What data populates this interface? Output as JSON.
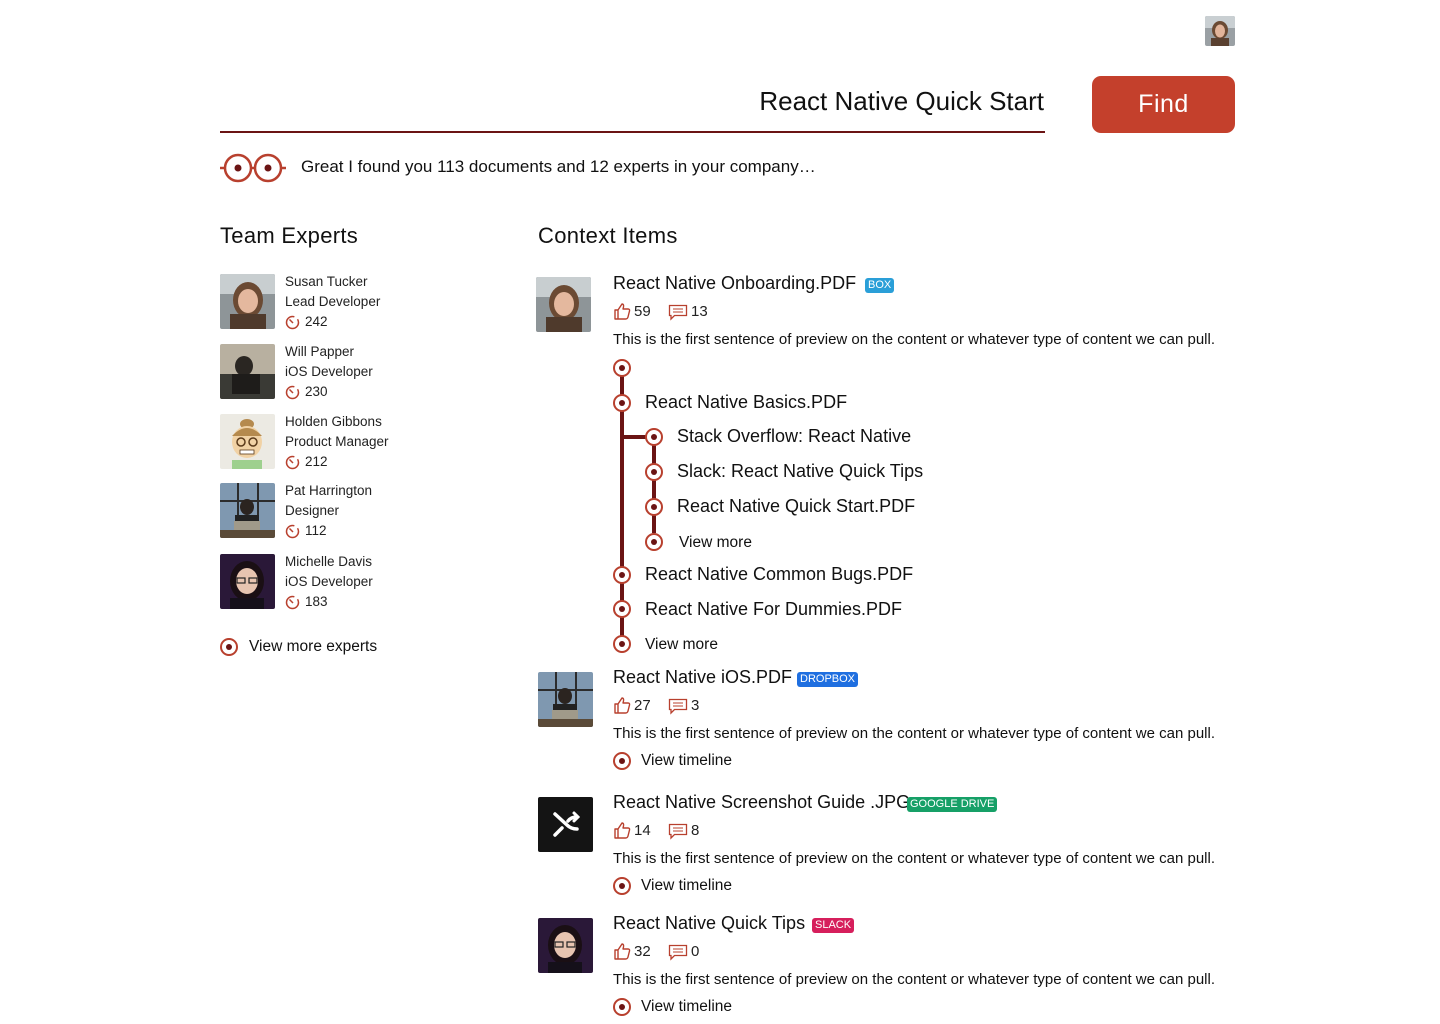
{
  "search": {
    "query": "React Native Quick Start",
    "button_label": "Find"
  },
  "result_summary": "Great I found you 113 documents and 12 experts in your company…",
  "experts_section": {
    "title": "Team Experts",
    "experts": [
      {
        "name": "Susan Tucker",
        "role": "Lead Developer",
        "score": "242"
      },
      {
        "name": "Will Papper",
        "role": "iOS Developer",
        "score": "230"
      },
      {
        "name": "Holden Gibbons",
        "role": "Product Manager",
        "score": "212"
      },
      {
        "name": "Pat Harrington",
        "role": "Designer",
        "score": "112"
      },
      {
        "name": "Michelle Davis",
        "role": "iOS Developer",
        "score": "183"
      }
    ],
    "view_more": "View more experts"
  },
  "context_section": {
    "title": "Context Items",
    "items": [
      {
        "title": "React Native Onboarding.PDF",
        "source": "BOX",
        "source_color": "#2a9fd8",
        "likes": "59",
        "comments": "13",
        "preview": "This is the first sentence of preview on the content or whatever type of content we can pull."
      },
      {
        "title": "React Native iOS.PDF",
        "source": "DROPBOX",
        "source_color": "#1f6fe0",
        "likes": "27",
        "comments": "3",
        "preview": "This is the first sentence of preview on the content or whatever type of content we can pull.",
        "link": "View timeline"
      },
      {
        "title": "React Native Screenshot Guide .JPG",
        "source": "GOOGLE DRIVE",
        "source_color": "#16a067",
        "likes": "14",
        "comments": "8",
        "preview": "This is the first sentence of preview on the content or whatever type of content we can pull.",
        "link": "View timeline"
      },
      {
        "title": "React Native Quick Tips",
        "source": "SLACK",
        "source_color": "#d61f5c",
        "likes": "32",
        "comments": "0",
        "preview": "This is the first sentence of preview on the content or whatever type of content we can pull.",
        "link": "View timeline"
      }
    ],
    "timeline": {
      "level1": [
        "React Native Basics.PDF",
        "React Native Common Bugs.PDF",
        "React Native For Dummies.PDF",
        "View more"
      ],
      "level2": [
        "Stack Overflow: React Native",
        "Slack: React Native Quick Tips",
        "React Native Quick Start.PDF",
        "View more"
      ]
    }
  }
}
